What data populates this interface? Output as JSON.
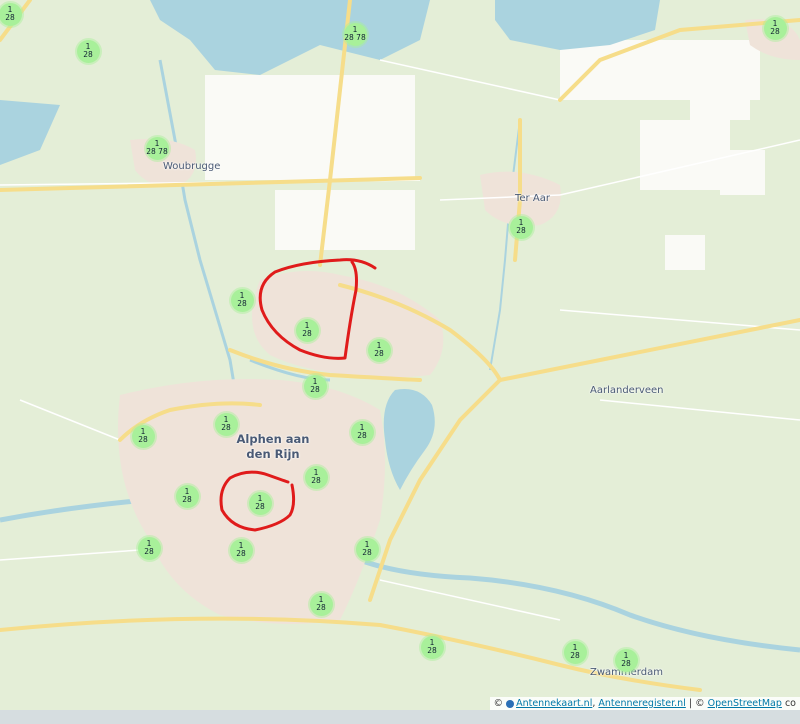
{
  "map": {
    "places": [
      {
        "id": "woubrugge",
        "label": "Woubrugge",
        "size": "small"
      },
      {
        "id": "ter-aar",
        "label": "Ter Aar",
        "size": "small"
      },
      {
        "id": "aarlanderveen",
        "label": "Aarlanderveen",
        "size": "small"
      },
      {
        "id": "alphen",
        "label": "Alphen aan den Rijn",
        "size": "big"
      },
      {
        "id": "zwammerdam",
        "label": "Zwammerdam",
        "size": "small"
      }
    ],
    "markers": [
      {
        "top": "1",
        "bottom": "28"
      },
      {
        "top": "1",
        "bottom": "28"
      },
      {
        "top": "1",
        "bottom": "28 78"
      },
      {
        "top": "1",
        "bottom": "28"
      },
      {
        "top": "1",
        "bottom": "28 78"
      },
      {
        "top": "1",
        "bottom": "28"
      },
      {
        "top": "1",
        "bottom": "28"
      },
      {
        "top": "1",
        "bottom": "28"
      },
      {
        "top": "1",
        "bottom": "28"
      },
      {
        "top": "1",
        "bottom": "28"
      },
      {
        "top": "1",
        "bottom": "28"
      },
      {
        "top": "1",
        "bottom": "28"
      },
      {
        "top": "1",
        "bottom": "28"
      },
      {
        "top": "1",
        "bottom": "28"
      },
      {
        "top": "1",
        "bottom": "28"
      },
      {
        "top": "1",
        "bottom": "28"
      },
      {
        "top": "1",
        "bottom": "28"
      },
      {
        "top": "1",
        "bottom": "28"
      },
      {
        "top": "1",
        "bottom": "28"
      },
      {
        "top": "1",
        "bottom": "28"
      },
      {
        "top": "1",
        "bottom": "28"
      },
      {
        "top": "1",
        "bottom": "28"
      },
      {
        "top": "1",
        "bottom": "28"
      }
    ],
    "colors": {
      "land": "#e4eed7",
      "water": "#aad3df",
      "urban": "#efe3d9",
      "fields": "#fafaf6",
      "road_major": "#f6dd8a",
      "highlight": "#e01b1b",
      "marker": "#a8f09a"
    }
  },
  "attribution": {
    "prefix": "©",
    "link1": "Antennekaart.nl",
    "sep1": ",",
    "link2": "Antenneregister.nl",
    "sep2": "| ©",
    "link3": "OpenStreetMap",
    "suffix": "co"
  }
}
